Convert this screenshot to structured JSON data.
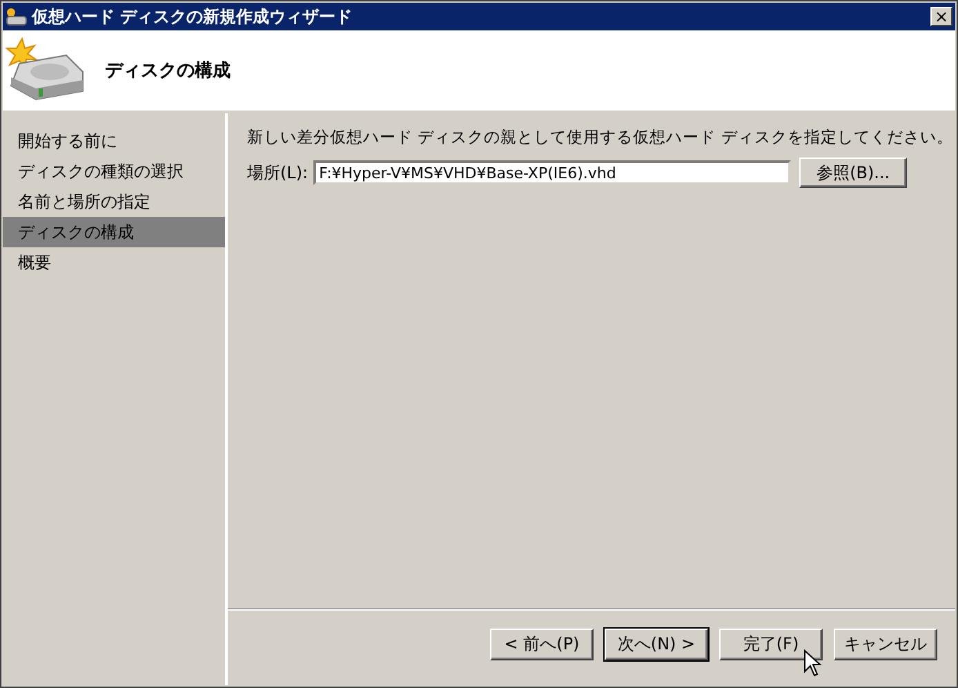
{
  "window": {
    "title": "仮想ハード ディスクの新規作成ウィザード",
    "close": "×"
  },
  "header": {
    "title": "ディスクの構成"
  },
  "steps": [
    {
      "label": "開始する前に",
      "selected": false
    },
    {
      "label": "ディスクの種類の選択",
      "selected": false
    },
    {
      "label": "名前と場所の指定",
      "selected": false
    },
    {
      "label": "ディスクの構成",
      "selected": true
    },
    {
      "label": "概要",
      "selected": false
    }
  ],
  "instruction": "新しい差分仮想ハード ディスクの親として使用する仮想ハード ディスクを指定してください。",
  "location": {
    "label": "場所(L):",
    "value": "F:¥Hyper-V¥MS¥VHD¥Base-XP(IE6).vhd",
    "browse": "参照(B)..."
  },
  "buttons": [
    {
      "label": "< 前へ(P)",
      "default": false
    },
    {
      "label": "次へ(N) >",
      "default": true
    },
    {
      "label": "完了(F)",
      "default": false
    },
    {
      "label": "キャンセル",
      "default": false
    }
  ]
}
